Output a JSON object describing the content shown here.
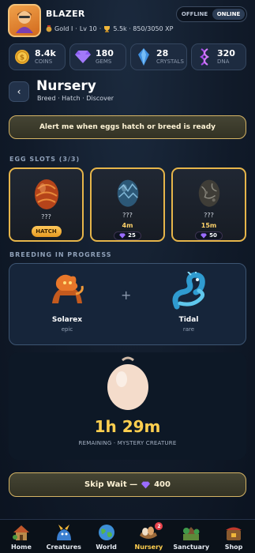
{
  "player": {
    "name": "BLAZER",
    "rank": "Gold I",
    "level": "Lv 10",
    "xp": "5.5k · 850/3050 XP",
    "separator": "·"
  },
  "mode": {
    "options": [
      "OFFLINE",
      "ONLINE"
    ],
    "selected": "ONLINE"
  },
  "currencies": [
    {
      "value": "8.4k",
      "label": "COINS",
      "icon": "coin-icon"
    },
    {
      "value": "180",
      "label": "GEMS",
      "icon": "gem-icon"
    },
    {
      "value": "28",
      "label": "CRYSTALS",
      "icon": "crystal-icon"
    },
    {
      "value": "320",
      "label": "DNA",
      "icon": "dna-icon"
    }
  ],
  "page": {
    "title": "Nursery",
    "subtitle": "Breed · Hatch · Discover",
    "back_label": "‹"
  },
  "alert_button": "Alert me when eggs hatch or breed is ready",
  "egg_slots": {
    "label": "EGG SLOTS (3/3)",
    "slots": [
      {
        "name": "???",
        "status": "ready",
        "action": "HATCH",
        "color": "#c9501c"
      },
      {
        "name": "???",
        "status": "incubating",
        "time": "4m",
        "cost": "25",
        "color": "#3a6a8a"
      },
      {
        "name": "???",
        "status": "incubating",
        "time": "15m",
        "cost": "50",
        "color": "#4b4a44"
      }
    ]
  },
  "breeding": {
    "label": "BREEDING IN PROGRESS",
    "plus": "+",
    "parents": [
      {
        "name": "Solarex",
        "rarity": "epic",
        "icon": "fire-lion-icon"
      },
      {
        "name": "Tidal",
        "rarity": "rare",
        "icon": "water-dragon-icon"
      }
    ]
  },
  "mystery": {
    "time": "1h 29m",
    "caption": "REMAINING · MYSTERY CREATURE"
  },
  "skip": {
    "label": "Skip Wait —",
    "cost": "400"
  },
  "nav": {
    "items": [
      {
        "label": "Home",
        "icon": "home-icon"
      },
      {
        "label": "Creatures",
        "icon": "creatures-icon"
      },
      {
        "label": "World",
        "icon": "world-icon"
      },
      {
        "label": "Nursery",
        "icon": "nursery-icon",
        "badge": "2",
        "active": true
      },
      {
        "label": "Sanctuary",
        "icon": "sanctuary-icon"
      },
      {
        "label": "Shop",
        "icon": "shop-icon"
      }
    ]
  },
  "colors": {
    "gold": "#ffcf4f",
    "border_gold": "#d5b465",
    "panel": "#16253a",
    "background": "#111b2a"
  }
}
